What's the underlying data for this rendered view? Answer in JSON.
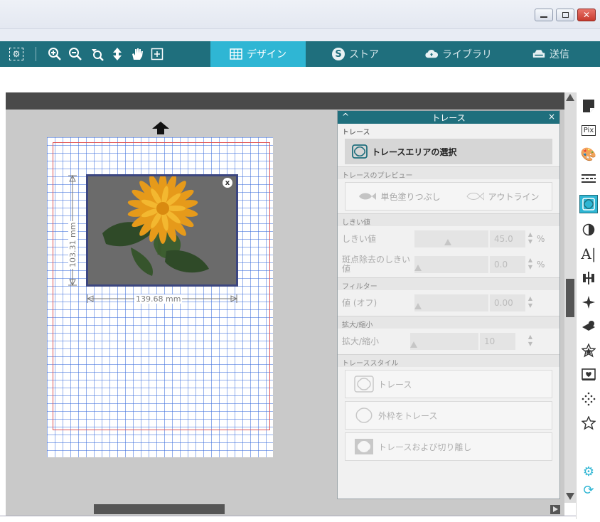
{
  "toolbar": {
    "tabs": [
      {
        "label": "デザイン",
        "icon": "grid-icon"
      },
      {
        "label": "ストア",
        "icon": "store-s-icon"
      },
      {
        "label": "ライブラリ",
        "icon": "cloud-library-icon"
      },
      {
        "label": "送信",
        "icon": "send-machine-icon"
      }
    ],
    "tools": [
      "palette-select-icon",
      "zoom-in-icon",
      "zoom-out-icon",
      "zoom-area-icon",
      "move-arrows-icon",
      "pan-hand-icon",
      "fit-to-page-icon"
    ]
  },
  "canvas": {
    "width_label": "139.68 mm",
    "height_label": "103.31 mm",
    "close_glyph": "x"
  },
  "trace_panel": {
    "title": "トレース",
    "close_glyph": "×",
    "section_trace": "トレース",
    "select_area_button": "トレースエリアの選択",
    "section_preview": "トレースのプレビュー",
    "preview_fill": "単色塗りつぶし",
    "preview_outline": "アウトライン",
    "section_threshold": "しきい値",
    "threshold_label": "しきい値",
    "threshold_value": "45.0",
    "threshold_unit": "%",
    "speckle_label": "斑点除去のしきい値",
    "speckle_value": "0.0",
    "speckle_unit": "%",
    "section_filter": "フィルター",
    "filter_label": "値 (オフ)",
    "filter_value": "0.00",
    "section_scale": "拡大/縮小",
    "scale_label": "拡大/縮小",
    "scale_value": "10",
    "section_style": "トレーススタイル",
    "style_trace": "トレース",
    "style_outer": "外枠をトレース",
    "style_trace_cut": "トレースおよび切り離し"
  },
  "sidebar_tools": [
    "page-setup-icon",
    "pixscan-icon",
    "fill-palette-icon",
    "line-style-icon",
    "trace-icon",
    "contrast-icon",
    "text-style-icon",
    "align-icon",
    "replicate-icon",
    "transform-icon",
    "library-star-icon",
    "design-store-icon",
    "offset-dots-icon",
    "favorite-star-icon",
    "settings-gear-icon",
    "sync-icon"
  ],
  "colors": {
    "toolbar": "#1f6f7d",
    "accent": "#2fb6d4",
    "grid": "#3c6edc",
    "cut_frame": "#e05050"
  }
}
